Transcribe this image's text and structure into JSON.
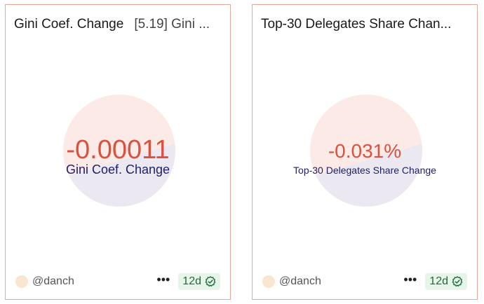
{
  "colors": {
    "border": "#e9a898",
    "value": "#d9513f",
    "label": "#1f2069",
    "circle_top": "#fbeae6",
    "circle_bottom": "#ebe8f1",
    "badge_bg": "#e6f4ea",
    "badge_text": "#1f6b3a"
  },
  "cards": [
    {
      "title": "Gini Coef. Change",
      "subtitle": "[5.19] Gini ...",
      "value": "-0.00011",
      "label": "Gini Coef. Change",
      "user": "@danch",
      "more": "•••",
      "age": "12d",
      "icon": "verified-check-icon"
    },
    {
      "title": "Top-30 Delegates Share Chan...",
      "subtitle": "",
      "value": "-0.031%",
      "label": "Top-30 Delegates Share Change",
      "user": "@danch",
      "more": "•••",
      "age": "12d",
      "icon": "verified-check-icon"
    }
  ]
}
